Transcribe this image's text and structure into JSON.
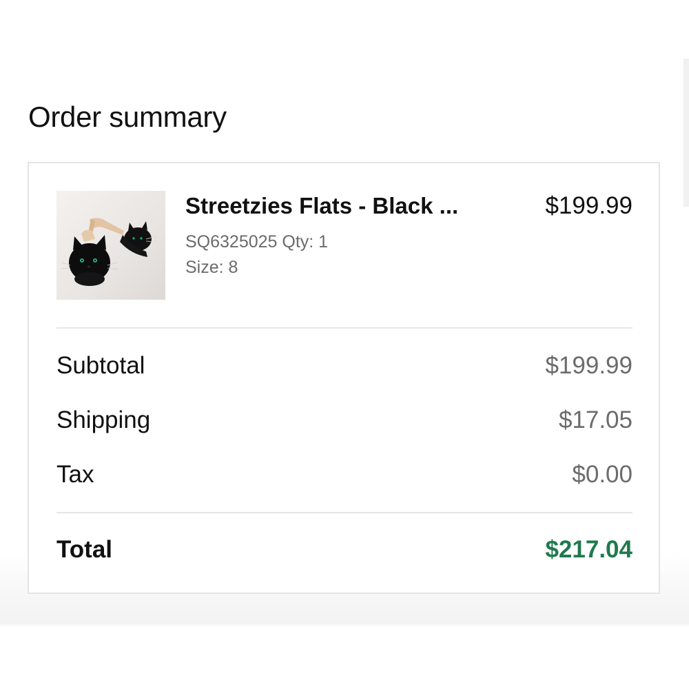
{
  "page": {
    "title": "Order summary"
  },
  "item": {
    "name": "Streetzies Flats - Black ...",
    "price": "$199.99",
    "sku_qty": "SQ6325025 Qty: 1",
    "size": "Size: 8",
    "image_alt": "black cat slipper heels"
  },
  "summary": {
    "subtotal_label": "Subtotal",
    "subtotal_value": "$199.99",
    "shipping_label": "Shipping",
    "shipping_value": "$17.05",
    "tax_label": "Tax",
    "tax_value": "$0.00",
    "total_label": "Total",
    "total_value": "$217.04"
  },
  "colors": {
    "total_value": "#1f7a4d",
    "muted_text": "#6b6b6b",
    "primary_text": "#111111",
    "border": "#e4e4e4"
  }
}
